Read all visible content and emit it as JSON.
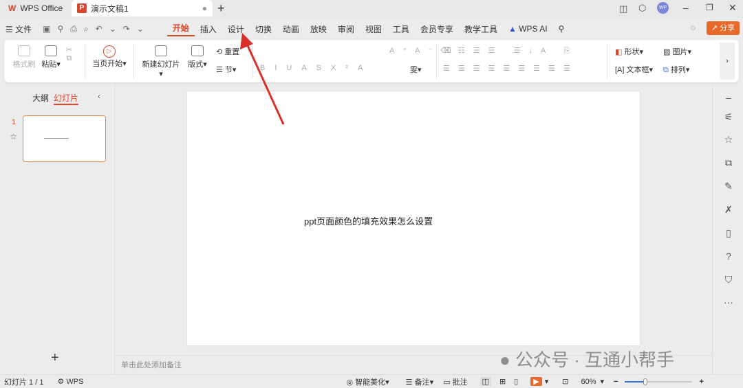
{
  "titlebar": {
    "app_tab": "WPS Office",
    "doc_tab": "演示文稿1",
    "new_tab": "+",
    "avatar": "WP"
  },
  "menu": {
    "file": "文件",
    "items": [
      "开始",
      "插入",
      "设计",
      "切换",
      "动画",
      "放映",
      "审阅",
      "视图",
      "工具",
      "会员专享",
      "教学工具"
    ],
    "active": "开始",
    "ai": "WPS AI",
    "share": "分享"
  },
  "ribbon": {
    "format_painter": "格式刷",
    "paste": "粘贴",
    "start_from_current": "当页开始",
    "new_slide": "新建幻灯片",
    "layout": "版式",
    "reset": "重置",
    "section": "节",
    "shape": "形状",
    "picture": "图片",
    "textbox": "文本框",
    "arrange": "排列"
  },
  "left_panel": {
    "tab_outline": "大纲",
    "tab_slides": "幻灯片",
    "slide_number": "1",
    "add": "+"
  },
  "slide": {
    "text": "ppt页面颜色的填充效果怎么设置"
  },
  "notes": {
    "placeholder": "单击此处添加备注"
  },
  "status": {
    "slide_count": "幻灯片 1 / 1",
    "theme": "WPS",
    "beautify": "智能美化",
    "notes": "备注",
    "comments": "批注",
    "zoom": "60%",
    "zoom_percent": 60
  },
  "watermark": "公众号 · 互通小帮手",
  "colors": {
    "accent": "#d5482c",
    "share": "#e8682a",
    "arrow": "#d9302c"
  }
}
